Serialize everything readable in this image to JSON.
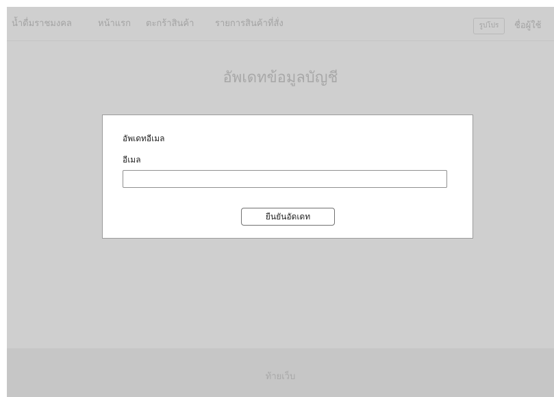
{
  "navbar": {
    "brand": "น้ำดื่มราชมงคล",
    "home": "หน้าแรก",
    "cart": "ตะกร้าสินค้า",
    "orders": "รายการสินค้าที่สั่ง",
    "profile_button": "รูปโปร",
    "username": "ชื่อผู้ใช้"
  },
  "page": {
    "title": "อัพเดทข้อมูลบัญชี"
  },
  "modal": {
    "title": "อัพเดทอีเมล",
    "email_label": "อีเมล",
    "email_value": "",
    "email_placeholder": "",
    "confirm_label": "ยืนยันอัดเดท"
  },
  "footer": {
    "text": "ท้ายเว็บ"
  }
}
